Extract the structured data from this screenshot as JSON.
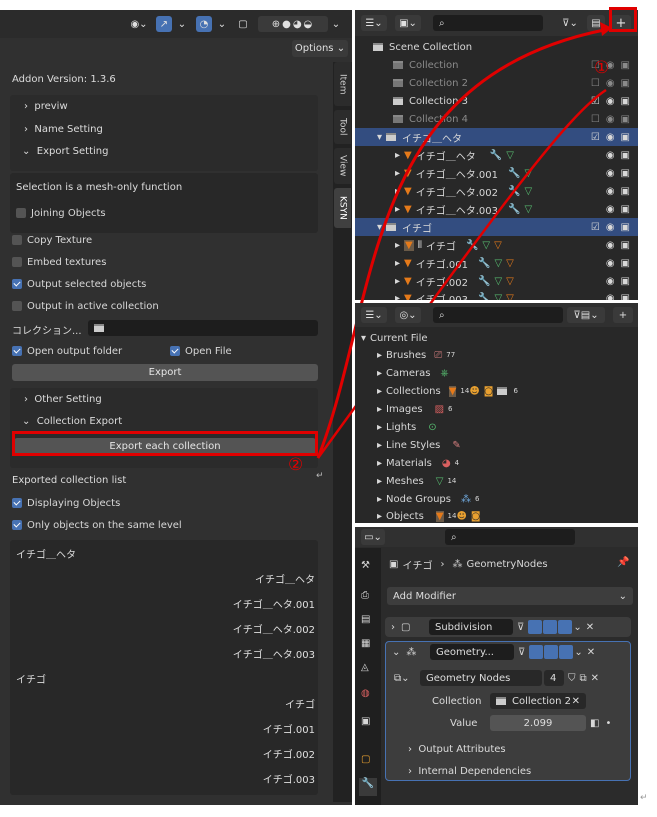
{
  "left_panel": {
    "header": {
      "options_label": "Options"
    },
    "tabs": [
      "Item",
      "Tool",
      "View",
      "KSYN"
    ],
    "addon_version": "Addon Version: 1.3.6",
    "sections": [
      "previw",
      "Name Setting",
      "Export Setting"
    ],
    "mesh_only_note": "Selection is a mesh-only function",
    "joining_objects": "Joining Objects",
    "copy_texture": "Copy Texture",
    "embed_textures": "Embed textures",
    "output_selected": "Output selected objects",
    "output_active": "Output in active collection",
    "collection_label": "コレクション...",
    "open_output_folder": "Open output folder",
    "open_file": "Open File",
    "export_button": "Export",
    "other_setting": "Other Setting",
    "collection_export": "Collection Export",
    "export_each_button": "Export each collection",
    "annotation_2": "②",
    "exported_list_title": "Exported collection list",
    "displaying_objects": "Displaying Objects",
    "only_same_level": "Only objects on the same level",
    "list": {
      "group1": "イチゴ＿ヘタ",
      "group1_items": [
        "イチゴ＿ヘタ",
        "イチゴ＿ヘタ.001",
        "イチゴ＿ヘタ.002",
        "イチゴ＿ヘタ.003"
      ],
      "group2": "イチゴ",
      "group2_items": [
        "イチゴ",
        "イチゴ.001",
        "イチゴ.002",
        "イチゴ.003"
      ]
    }
  },
  "outliner": {
    "rows": [
      "Scene Collection",
      "Collection",
      "Collection 2",
      "Collection 3",
      "Collection 4",
      "イチゴ＿ヘタ",
      "イチゴ＿ヘタ",
      "イチゴ＿ヘタ.001",
      "イチゴ＿ヘタ.002",
      "イチゴ＿ヘタ.003",
      "イチゴ",
      "イチゴ",
      "イチゴ.001",
      "イチゴ.002",
      "イチゴ.003"
    ],
    "plus": "+",
    "annotation_1": "①"
  },
  "data_panel": {
    "root": "Current File",
    "items": [
      {
        "label": "Brushes",
        "count": "77"
      },
      {
        "label": "Cameras",
        "count": ""
      },
      {
        "label": "Collections",
        "count": "14"
      },
      {
        "label": "Images",
        "count": "6"
      },
      {
        "label": "Lights",
        "count": ""
      },
      {
        "label": "Line Styles",
        "count": ""
      },
      {
        "label": "Materials",
        "count": "4"
      },
      {
        "label": "Meshes",
        "count": "14"
      },
      {
        "label": "Node Groups",
        "count": "6"
      },
      {
        "label": "Objects",
        "count": "14"
      }
    ],
    "collections_extra": "6"
  },
  "properties": {
    "breadcrumb_object": "イチゴ",
    "breadcrumb_modifier": "GeometryNodes",
    "add_modifier": "Add Modifier",
    "mod1_name": "Subdivision",
    "mod2_name": "Geometry...",
    "node_group": "Geometry Nodes",
    "node_users": "4",
    "collection_label": "Collection",
    "collection_value": "Collection 2",
    "value_label": "Value",
    "value_value": "2.099",
    "output_attributes": "Output Attributes",
    "internal_dependencies": "Internal Dependencies"
  },
  "colors": {
    "accent": "#4772b3",
    "annotation_red": "#e00000",
    "outliner_selected": "#334d80"
  }
}
